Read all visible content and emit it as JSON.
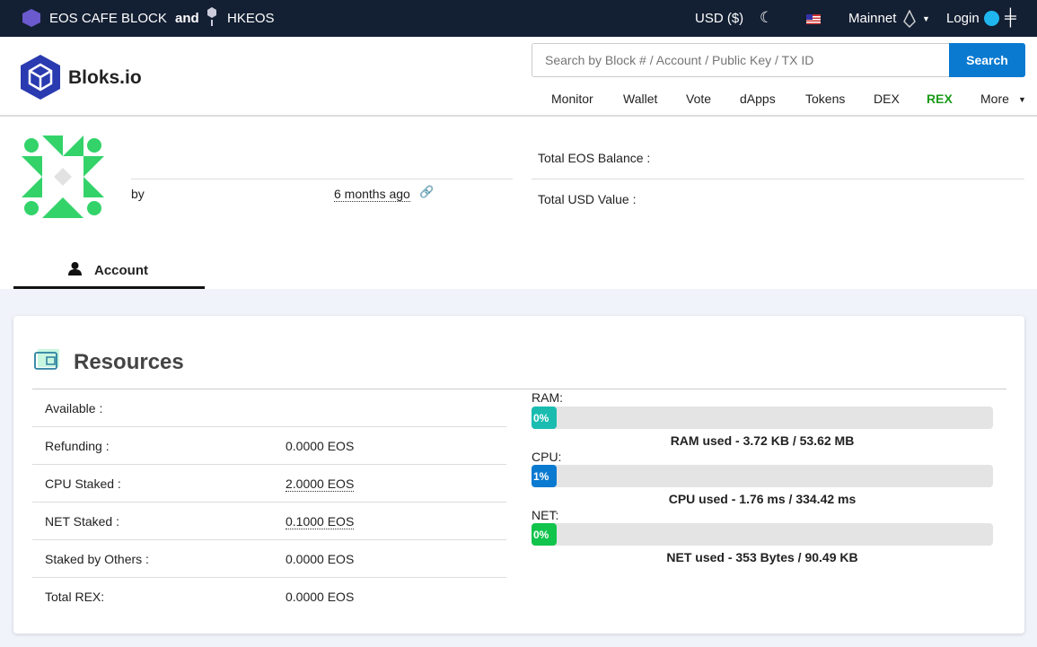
{
  "topbar": {
    "producers": "EOS CAFE BLOCK",
    "and": "and",
    "producer2": "HKEOS",
    "currency": "USD ($)",
    "network": "Mainnet",
    "login": "Login"
  },
  "header": {
    "brand": "Bloks.io",
    "search_placeholder": "Search by Block # / Account / Public Key / TX ID",
    "search_button": "Search",
    "nav": [
      "Monitor",
      "Wallet",
      "Vote",
      "dApps",
      "Tokens",
      "DEX",
      "REX",
      "More"
    ]
  },
  "profile": {
    "by": "by",
    "created": "6 months ago",
    "balance_label": "Total EOS Balance :",
    "usd_label": "Total USD Value :"
  },
  "tabs": {
    "account": "Account"
  },
  "resources": {
    "title": "Resources",
    "rows": [
      {
        "label": "Available :",
        "value": ""
      },
      {
        "label": "Refunding :",
        "value": "0.0000 EOS"
      },
      {
        "label": "CPU Staked :",
        "value": "2.0000 EOS"
      },
      {
        "label": "NET Staked :",
        "value": "0.1000 EOS"
      },
      {
        "label": "Staked by Others :",
        "value": "0.0000 EOS"
      },
      {
        "label": "Total REX:",
        "value": "0.0000 EOS"
      }
    ],
    "meters": [
      {
        "label": "RAM:",
        "percent": "0%",
        "caption": "RAM used - 3.72 KB / 53.62 MB",
        "color": "#1abcb0"
      },
      {
        "label": "CPU:",
        "percent": "1%",
        "caption": "CPU used - 1.76 ms / 334.42 ms",
        "color": "#0a7ad1"
      },
      {
        "label": "NET:",
        "percent": "0%",
        "caption": "NET used - 353 Bytes / 90.49 KB",
        "color": "#10c44c"
      }
    ]
  }
}
